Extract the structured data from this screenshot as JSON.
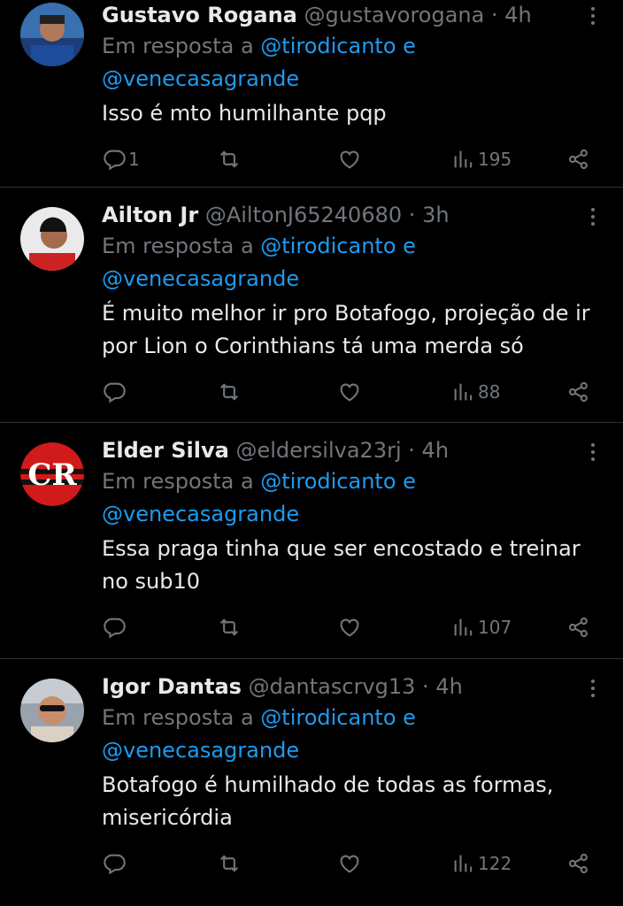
{
  "reply_prefix": "Em resposta a",
  "reply_mention_1": "@tirodicanto",
  "reply_connector": "e",
  "reply_mention_2": "@venecasagrande",
  "colors": {
    "background": "#000000",
    "text": "#e7e9ea",
    "muted": "#71767b",
    "link": "#1d9bf0",
    "divider": "#2f3336"
  },
  "icons": [
    "reply-icon",
    "retweet-icon",
    "like-icon",
    "views-icon",
    "share-icon",
    "more-icon"
  ],
  "tweets": [
    {
      "name": "Gustavo Rogana",
      "handle": "@gustavorogana",
      "sep": "·",
      "time": "4h",
      "text": "Isso é mto humilhante pqp",
      "replies": "1",
      "views": "195"
    },
    {
      "name": "Ailton Jr",
      "handle": "@AiltonJ65240680",
      "sep": "·",
      "time": "3h",
      "text": "É muito melhor ir pro Botafogo, projeção de ir por Lion o Corinthians tá uma merda só",
      "replies": "",
      "views": "88"
    },
    {
      "name": "Elder Silva",
      "handle": "@eldersilva23rj",
      "sep": "·",
      "time": "4h",
      "text": "Essa praga tinha que ser encostado e treinar no sub10",
      "replies": "",
      "views": "107"
    },
    {
      "name": "Igor Dantas",
      "handle": "@dantascrvg13",
      "sep": "·",
      "time": "4h",
      "text": "Botafogo é humilhado de todas as formas, misericórdia",
      "replies": "",
      "views": "122"
    }
  ]
}
